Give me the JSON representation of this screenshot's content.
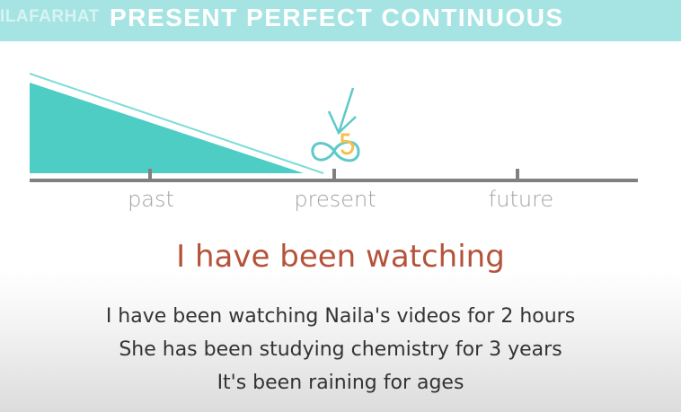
{
  "header": {
    "watermark": "ILAFARHAT",
    "title": "PRESENT PERFECT CONTINUOUS"
  },
  "timeline": {
    "labels": [
      "past",
      "present",
      "future"
    ]
  },
  "heading": "I have been watching",
  "examples": [
    "I have been watching Naila's videos for 2 hours",
    "She has been studying chemistry for 3 years",
    "It's been raining for ages"
  ],
  "colors": {
    "header_bar": "#a6e4e4",
    "wedge": "#4ecdc4",
    "heading": "#b5533a",
    "timeline_line": "#808080",
    "symbol_gold": "#f2c14e"
  }
}
